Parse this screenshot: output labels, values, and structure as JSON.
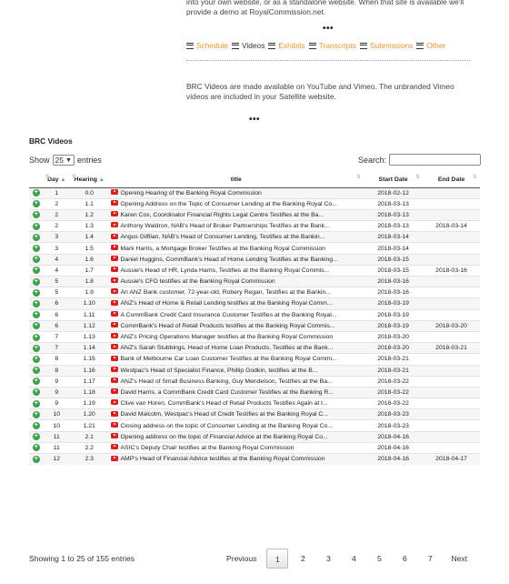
{
  "intro": {
    "text": "into your own website, or as a standalone website. When that site is available we'll provide a demo at RoyalCommission.net."
  },
  "separator": "•••",
  "nav": {
    "items": [
      {
        "label": "Schedule",
        "active": false
      },
      {
        "label": "Videos",
        "active": true
      },
      {
        "label": "Exhibits",
        "active": false
      },
      {
        "label": "Transcripts",
        "active": false
      },
      {
        "label": "Submissions",
        "active": false
      },
      {
        "label": "Other",
        "active": false
      }
    ],
    "link_color": "#e8962b"
  },
  "video_note": "BRC Videos are made available on YouTube and Vimeo. The unbranded Vimeo videos are included in your Satellite website.",
  "section_title": "BRC Videos",
  "length_control": {
    "prefix": "Show",
    "selected": "25",
    "suffix": "entries"
  },
  "search": {
    "label": "Search:",
    "value": ""
  },
  "table": {
    "columns": [
      "Day",
      "Hearing",
      "title",
      "Start Date",
      "End Date"
    ],
    "rows": [
      {
        "day": "1",
        "hearing": "0.0",
        "title": "Opening Hearing of the Banking Royal Commission",
        "start": "2018-02-12",
        "end": ""
      },
      {
        "day": "2",
        "hearing": "1.1",
        "title": "Opening Address on the Topic of Consumer Lending at the Banking Royal Co...",
        "start": "2018-03-13",
        "end": ""
      },
      {
        "day": "2",
        "hearing": "1.2",
        "title": "Karen Cox, Coordinator Financial Rights Legal Centre Testifies at the Ba...",
        "start": "2018-03-13",
        "end": ""
      },
      {
        "day": "2",
        "hearing": "1.3",
        "title": "Anthony Waldron, NAB's Head of Broker Partnerships Testifies at the Bank...",
        "start": "2018-03-13",
        "end": "2018-03-14"
      },
      {
        "day": "3",
        "hearing": "1.4",
        "title": "Angus Gilfilan, NAB's Head of Consumer Lending, Testifies at the Bankin...",
        "start": "2018-03-14",
        "end": ""
      },
      {
        "day": "3",
        "hearing": "1.5",
        "title": "Mark Harris, a Mortgage Broker Testifies at the Banking Royal Commission",
        "start": "2018-03-14",
        "end": ""
      },
      {
        "day": "4",
        "hearing": "1.6",
        "title": "Daniel Huggins, CommBank's Head of Home Lending Testifies at the Banking...",
        "start": "2018-03-15",
        "end": ""
      },
      {
        "day": "4",
        "hearing": "1.7",
        "title": "Aussie's Head of HR, Lynda Harris, Testifies at the Banking Royal Commis...",
        "start": "2018-03-15",
        "end": "2018-03-16"
      },
      {
        "day": "5",
        "hearing": "1.8",
        "title": "Aussie's CFO testifies at the Banking Royal Commission",
        "start": "2018-03-16",
        "end": ""
      },
      {
        "day": "5",
        "hearing": "1.9",
        "title": "An ANZ Bank customer, 72-year-old, Robery Regan, Testifies at the Bankin...",
        "start": "2018-03-16",
        "end": ""
      },
      {
        "day": "6",
        "hearing": "1.10",
        "title": "ANZ's Head of Home & Retail Lending testifies at the Banking Royal Comm...",
        "start": "2018-03-19",
        "end": ""
      },
      {
        "day": "6",
        "hearing": "1.11",
        "title": "A CommBank Credit Card Insurance Customer Testifies at the Banking Royal...",
        "start": "2018-03-19",
        "end": ""
      },
      {
        "day": "6",
        "hearing": "1.12",
        "title": "CommBank's Head of Retail Products testifies at the Banking Royal Commis...",
        "start": "2018-03-19",
        "end": "2018-03-20"
      },
      {
        "day": "7",
        "hearing": "1.13",
        "title": "ANZ's Pricing Operations Manager testifies at the Banking Royal Commission",
        "start": "2018-03-20",
        "end": ""
      },
      {
        "day": "7",
        "hearing": "1.14",
        "title": "ANZ's Sarah Stubbings, Head of Home Loan Products, Testifies at the Bank...",
        "start": "2018-03-20",
        "end": "2018-03-21"
      },
      {
        "day": "8",
        "hearing": "1.15",
        "title": "Bank of Melbourne Car Loan Customer Testifies at the Banking Royal Commi...",
        "start": "2018-03-21",
        "end": ""
      },
      {
        "day": "8",
        "hearing": "1.16",
        "title": "Westpac's Head of Specialist Finance, Phillip Godkin, testifies at the B...",
        "start": "2018-03-21",
        "end": ""
      },
      {
        "day": "9",
        "hearing": "1.17",
        "title": "ANZ's Head of Small Business Banking, Guy Mendelson, Testifies at the Ba...",
        "start": "2018-03-22",
        "end": ""
      },
      {
        "day": "9",
        "hearing": "1.18",
        "title": "David Harris, a CommBank Credit Card Customer Testifies at the Banking R...",
        "start": "2018-03-22",
        "end": ""
      },
      {
        "day": "9",
        "hearing": "1.19",
        "title": "Clive van Horen, CommBank's Head of Retail Products Testifies Again at t...",
        "start": "2018-03-22",
        "end": ""
      },
      {
        "day": "10",
        "hearing": "1.20",
        "title": "David Malcolm, Westpac's Head of Credit Testifies at the Banking Royal C...",
        "start": "2018-03-23",
        "end": ""
      },
      {
        "day": "10",
        "hearing": "1.21",
        "title": "Closing address on the topic of Consumer Lending at the Banking Royal Co...",
        "start": "2018-03-23",
        "end": ""
      },
      {
        "day": "11",
        "hearing": "2.1",
        "title": "Opening address on the topic of Financial Advice at the Banking Royal Co...",
        "start": "2018-04-16",
        "end": ""
      },
      {
        "day": "11",
        "hearing": "2.2",
        "title": "ASIC's Deputy Chair testifies at the Banking Royal Commission",
        "start": "2018-04-16",
        "end": ""
      },
      {
        "day": "12",
        "hearing": "2.3",
        "title": "AMP's Head of Financial Advice testifies at the Banking Royal Commission",
        "start": "2018-04-16",
        "end": "2018-04-17"
      }
    ]
  },
  "footer": {
    "info": "Showing 1 to 25 of 155 entries",
    "previous": "Previous",
    "next": "Next",
    "pages": [
      "1",
      "2",
      "3",
      "4",
      "5",
      "6",
      "7"
    ],
    "current_page": "1"
  }
}
